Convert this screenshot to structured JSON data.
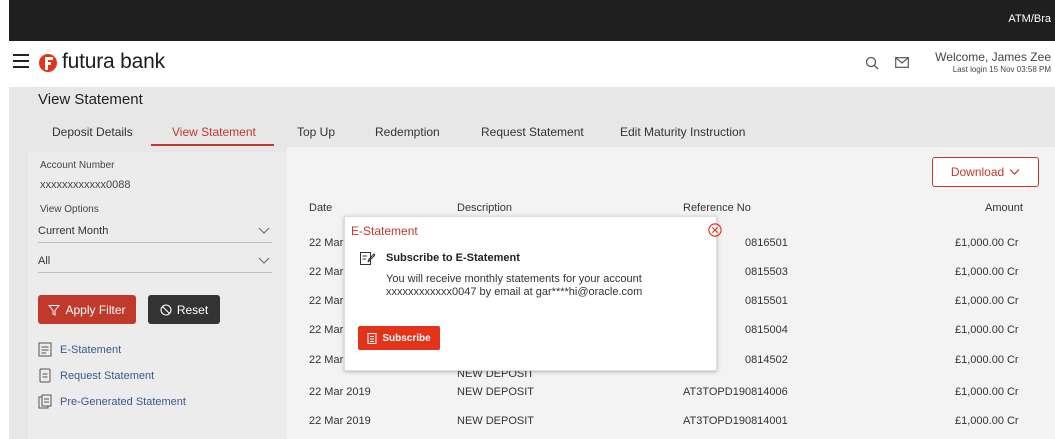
{
  "topbar": {
    "right_text": "ATM/Bra"
  },
  "header": {
    "logo_text": "futura bank",
    "welcome": "Welcome, James Zee",
    "last_login": "Last login 15 Nov 03:58 PM"
  },
  "page": {
    "title": "View Statement"
  },
  "tabs": [
    {
      "label": "Deposit Details"
    },
    {
      "label": "View Statement"
    },
    {
      "label": "Top Up"
    },
    {
      "label": "Redemption"
    },
    {
      "label": "Request Statement"
    },
    {
      "label": "Edit Maturity Instruction"
    }
  ],
  "left": {
    "account_label": "Account Number",
    "account_value": "xxxxxxxxxxxx0088",
    "options_label": "View Options",
    "period_select": "Current Month",
    "type_select": "All",
    "apply_label": "Apply Filter",
    "reset_label": "Reset",
    "links": [
      {
        "label": "E-Statement"
      },
      {
        "label": "Request Statement"
      },
      {
        "label": "Pre-Generated Statement"
      }
    ]
  },
  "main": {
    "download_label": "Download",
    "columns": {
      "date": "Date",
      "description": "Description",
      "reference": "Reference No",
      "amount": "Amount"
    },
    "rows": [
      {
        "date": "22 Mar",
        "description": "",
        "reference": "0816501",
        "amount": "£1,000.00 Cr"
      },
      {
        "date": "22 Mar",
        "description": "",
        "reference": "0815503",
        "amount": "£1,000.00 Cr"
      },
      {
        "date": "22 Mar",
        "description": "",
        "reference": "0815501",
        "amount": "£1,000.00 Cr"
      },
      {
        "date": "22 Mar",
        "description": "",
        "reference": "0815004",
        "amount": "£1,000.00 Cr"
      },
      {
        "date": "22 Mar",
        "description": "NEW DEPOSIT",
        "reference": "0814502",
        "amount": "£1,000.00 Cr"
      },
      {
        "date": "22 Mar 2019",
        "description": "NEW DEPOSIT",
        "reference": "AT3TOPD190814006",
        "amount": "£1,000.00 Cr"
      },
      {
        "date": "22 Mar 2019",
        "description": "NEW DEPOSIT",
        "reference": "AT3TOPD190814001",
        "amount": "£1,000.00 Cr"
      }
    ]
  },
  "modal": {
    "title": "E-Statement",
    "subtitle": "Subscribe to E-Statement",
    "body_line1": "You will receive monthly statements for your account",
    "body_line2": "xxxxxxxxxxxx0047 by email at gar****hi@oracle.com",
    "subscribe_label": "Subscribe"
  },
  "colors": {
    "accent": "#c0392b",
    "subscribe": "#e4331b",
    "link": "#3a5b8c"
  }
}
